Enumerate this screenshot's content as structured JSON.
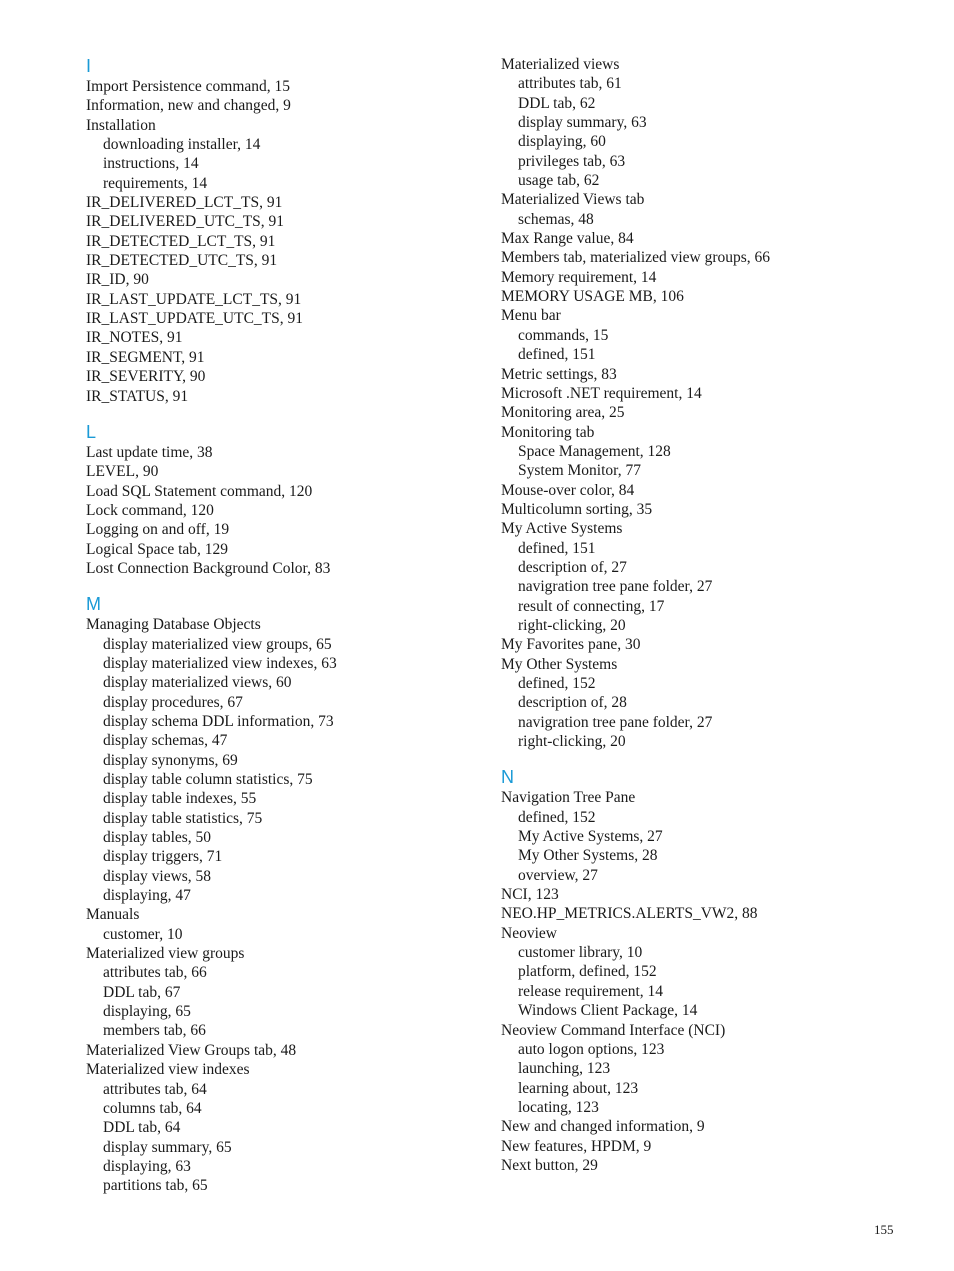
{
  "page": {
    "number": "155",
    "accent_color": "#1a9ad6"
  },
  "columns": [
    {
      "sections": [
        {
          "letter": "I",
          "entries": [
            {
              "text": "Import Persistence command, 15",
              "level": 0
            },
            {
              "text": "Information, new and changed, 9",
              "level": 0
            },
            {
              "text": "Installation",
              "level": 0
            },
            {
              "text": "downloading installer, 14",
              "level": 1
            },
            {
              "text": "instructions, 14",
              "level": 1
            },
            {
              "text": "requirements, 14",
              "level": 1
            },
            {
              "text": "IR_DELIVERED_LCT_TS, 91",
              "level": 0
            },
            {
              "text": "IR_DELIVERED_UTC_TS, 91",
              "level": 0
            },
            {
              "text": "IR_DETECTED_LCT_TS, 91",
              "level": 0
            },
            {
              "text": "IR_DETECTED_UTC_TS, 91",
              "level": 0
            },
            {
              "text": "IR_ID, 90",
              "level": 0
            },
            {
              "text": "IR_LAST_UPDATE_LCT_TS, 91",
              "level": 0
            },
            {
              "text": "IR_LAST_UPDATE_UTC_TS, 91",
              "level": 0
            },
            {
              "text": "IR_NOTES, 91",
              "level": 0
            },
            {
              "text": "IR_SEGMENT, 91",
              "level": 0
            },
            {
              "text": "IR_SEVERITY, 90",
              "level": 0
            },
            {
              "text": "IR_STATUS, 91",
              "level": 0
            }
          ]
        },
        {
          "letter": "L",
          "entries": [
            {
              "text": "Last update time, 38",
              "level": 0
            },
            {
              "text": "LEVEL, 90",
              "level": 0
            },
            {
              "text": "Load SQL Statement command, 120",
              "level": 0
            },
            {
              "text": "Lock command, 120",
              "level": 0
            },
            {
              "text": "Logging on and off, 19",
              "level": 0
            },
            {
              "text": "Logical Space tab, 129",
              "level": 0
            },
            {
              "text": "Lost Connection Background Color, 83",
              "level": 0
            }
          ]
        },
        {
          "letter": "M",
          "entries": [
            {
              "text": "Managing Database Objects",
              "level": 0
            },
            {
              "text": "display materialized view groups, 65",
              "level": 1
            },
            {
              "text": "display materialized view indexes, 63",
              "level": 1
            },
            {
              "text": "display materialized views, 60",
              "level": 1
            },
            {
              "text": "display procedures, 67",
              "level": 1
            },
            {
              "text": "display schema DDL information, 73",
              "level": 1
            },
            {
              "text": "display schemas, 47",
              "level": 1
            },
            {
              "text": "display synonyms, 69",
              "level": 1
            },
            {
              "text": "display table column statistics, 75",
              "level": 1
            },
            {
              "text": "display table indexes, 55",
              "level": 1
            },
            {
              "text": "display table statistics, 75",
              "level": 1
            },
            {
              "text": "display tables, 50",
              "level": 1
            },
            {
              "text": "display triggers, 71",
              "level": 1
            },
            {
              "text": "display views, 58",
              "level": 1
            },
            {
              "text": "displaying, 47",
              "level": 1
            },
            {
              "text": "Manuals",
              "level": 0
            },
            {
              "text": "customer, 10",
              "level": 1
            },
            {
              "text": "Materialized view groups",
              "level": 0
            },
            {
              "text": "attributes tab, 66",
              "level": 1
            },
            {
              "text": "DDL tab, 67",
              "level": 1
            },
            {
              "text": "displaying, 65",
              "level": 1
            },
            {
              "text": "members tab, 66",
              "level": 1
            },
            {
              "text": "Materialized View Groups tab, 48",
              "level": 0
            },
            {
              "text": "Materialized view indexes",
              "level": 0
            },
            {
              "text": "attributes tab, 64",
              "level": 1
            },
            {
              "text": "columns tab, 64",
              "level": 1
            },
            {
              "text": "DDL tab, 64",
              "level": 1
            },
            {
              "text": "display summary, 65",
              "level": 1
            },
            {
              "text": "displaying, 63",
              "level": 1
            },
            {
              "text": "partitions tab, 65",
              "level": 1
            }
          ]
        }
      ]
    },
    {
      "sections": [
        {
          "letter": "",
          "entries": [
            {
              "text": "Materialized views",
              "level": 0
            },
            {
              "text": "attributes tab, 61",
              "level": 1
            },
            {
              "text": "DDL tab, 62",
              "level": 1
            },
            {
              "text": "display summary, 63",
              "level": 1
            },
            {
              "text": "displaying, 60",
              "level": 1
            },
            {
              "text": "privileges tab, 63",
              "level": 1
            },
            {
              "text": "usage tab, 62",
              "level": 1
            },
            {
              "text": "Materialized Views tab",
              "level": 0
            },
            {
              "text": "schemas, 48",
              "level": 1
            },
            {
              "text": "Max Range value, 84",
              "level": 0
            },
            {
              "text": "Members tab, materialized view groups, 66",
              "level": 0
            },
            {
              "text": "Memory requirement, 14",
              "level": 0
            },
            {
              "text": "MEMORY USAGE MB, 106",
              "level": 0
            },
            {
              "text": "Menu bar",
              "level": 0
            },
            {
              "text": "commands, 15",
              "level": 1
            },
            {
              "text": "defined, 151",
              "level": 1
            },
            {
              "text": "Metric settings, 83",
              "level": 0
            },
            {
              "text": "Microsoft .NET requirement, 14",
              "level": 0
            },
            {
              "text": "Monitoring area, 25",
              "level": 0
            },
            {
              "text": "Monitoring tab",
              "level": 0
            },
            {
              "text": "Space Management, 128",
              "level": 1
            },
            {
              "text": "System Monitor, 77",
              "level": 1
            },
            {
              "text": "Mouse-over color, 84",
              "level": 0
            },
            {
              "text": "Multicolumn sorting, 35",
              "level": 0
            },
            {
              "text": "My Active Systems",
              "level": 0
            },
            {
              "text": "defined, 151",
              "level": 1
            },
            {
              "text": "description of, 27",
              "level": 1
            },
            {
              "text": "navigration tree pane folder, 27",
              "level": 1
            },
            {
              "text": "result of connecting, 17",
              "level": 1
            },
            {
              "text": "right-clicking, 20",
              "level": 1
            },
            {
              "text": "My Favorites pane, 30",
              "level": 0
            },
            {
              "text": "My Other Systems",
              "level": 0
            },
            {
              "text": "defined, 152",
              "level": 1
            },
            {
              "text": "description of, 28",
              "level": 1
            },
            {
              "text": "navigration tree pane folder, 27",
              "level": 1
            },
            {
              "text": "right-clicking, 20",
              "level": 1
            }
          ]
        },
        {
          "letter": "N",
          "entries": [
            {
              "text": "Navigation Tree Pane",
              "level": 0
            },
            {
              "text": "defined, 152",
              "level": 1
            },
            {
              "text": "My Active Systems, 27",
              "level": 1
            },
            {
              "text": "My Other Systems, 28",
              "level": 1
            },
            {
              "text": "overview, 27",
              "level": 1
            },
            {
              "text": "NCI, 123",
              "level": 0
            },
            {
              "text": "NEO.HP_METRICS.ALERTS_VW2, 88",
              "level": 0
            },
            {
              "text": "Neoview",
              "level": 0
            },
            {
              "text": "customer library, 10",
              "level": 1
            },
            {
              "text": "platform, defined, 152",
              "level": 1
            },
            {
              "text": "release requirement, 14",
              "level": 1
            },
            {
              "text": "Windows Client Package, 14",
              "level": 1
            },
            {
              "text": "Neoview Command Interface (NCI)",
              "level": 0
            },
            {
              "text": "auto logon options, 123",
              "level": 1
            },
            {
              "text": "launching, 123",
              "level": 1
            },
            {
              "text": "learning about, 123",
              "level": 1
            },
            {
              "text": "locating, 123",
              "level": 1
            },
            {
              "text": "New and changed information, 9",
              "level": 0
            },
            {
              "text": "New features, HPDM, 9",
              "level": 0
            },
            {
              "text": "Next button, 29",
              "level": 0
            }
          ]
        }
      ]
    }
  ]
}
